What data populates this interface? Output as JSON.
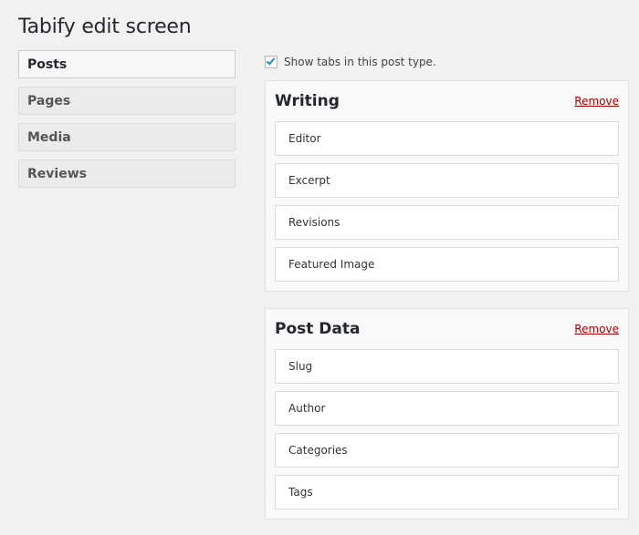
{
  "page": {
    "title": "Tabify edit screen"
  },
  "sidebar": {
    "items": [
      {
        "label": "Posts",
        "active": true
      },
      {
        "label": "Pages",
        "active": false
      },
      {
        "label": "Media",
        "active": false
      },
      {
        "label": "Reviews",
        "active": false
      }
    ]
  },
  "settings": {
    "show_tabs_label": "Show tabs in this post type.",
    "show_tabs_checked": true
  },
  "groups": [
    {
      "title": "Writing",
      "remove_label": "Remove",
      "items": [
        "Editor",
        "Excerpt",
        "Revisions",
        "Featured Image"
      ]
    },
    {
      "title": "Post Data",
      "remove_label": "Remove",
      "items": [
        "Slug",
        "Author",
        "Categories",
        "Tags"
      ]
    }
  ],
  "colors": {
    "accent": "#1e8cbe",
    "remove": "#aa0000",
    "background": "#f1f1f1"
  }
}
